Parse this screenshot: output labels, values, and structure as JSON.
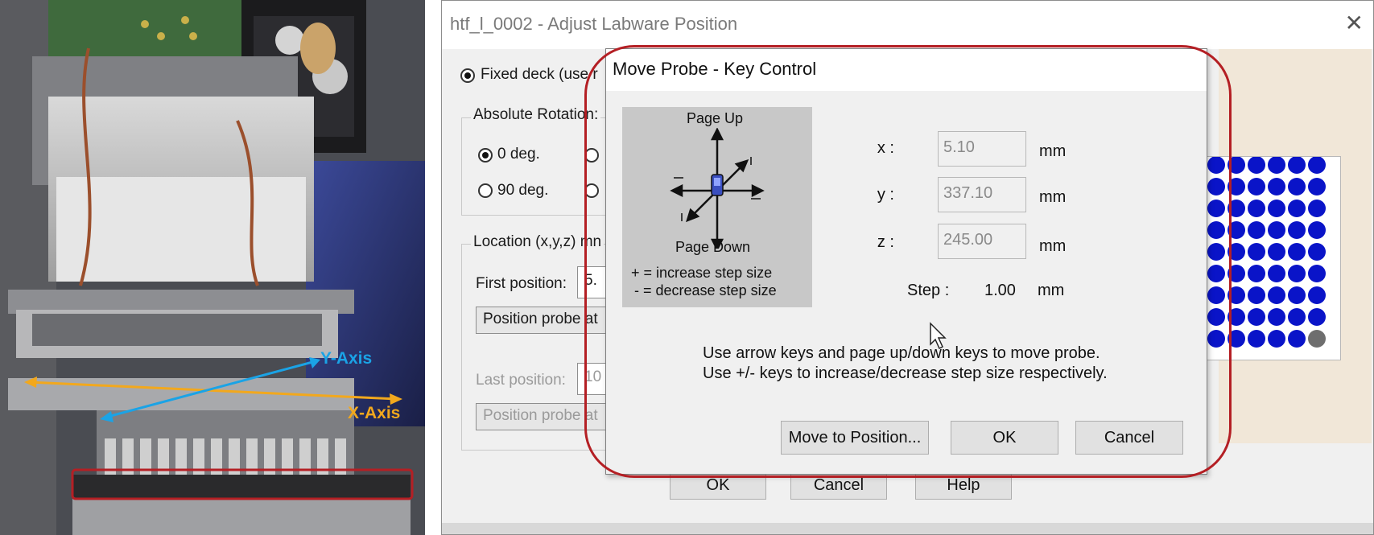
{
  "photo": {
    "y_axis_label": "Y-Axis",
    "x_axis_label": "X-Axis",
    "colors": {
      "y_axis": "#1aa3e6",
      "x_axis": "#f2a81d",
      "highlight": "#b41f24"
    }
  },
  "main_dialog": {
    "title": "htf_l_0002 - Adjust Labware Position",
    "close_icon": "close-icon",
    "fixed_deck_label": "Fixed deck (use r",
    "absolute_rotation_label": "Absolute Rotation:",
    "rotation_options": [
      "0 deg.",
      "90 deg."
    ],
    "location_label": "Location (x,y,z) mn",
    "first_position_label": "First position:",
    "first_position_value": "5.",
    "position_probe_1": "Position probe at",
    "last_position_label": "Last position:",
    "last_position_value": "10",
    "position_probe_2": "Position probe at",
    "buttons": {
      "ok": "OK",
      "cancel": "Cancel",
      "help": "Help"
    }
  },
  "probe_dialog": {
    "title": "Move Probe - Key Control",
    "keypad": {
      "page_up": "Page Up",
      "page_down": "Page Down",
      "increase_hint": "+ = increase step size",
      "decrease_hint": "- = decrease step size"
    },
    "coords": {
      "x_label": "x :",
      "x_value": "5.10",
      "y_label": "y :",
      "y_value": "337.10",
      "z_label": "z :",
      "z_value": "245.00",
      "unit": "mm"
    },
    "step_label": "Step :",
    "step_value": "1.00",
    "step_unit": "mm",
    "help_line_1": "Use arrow keys and page up/down keys to move probe.",
    "help_line_2": "Use +/- keys to increase/decrease step size respectively.",
    "buttons": {
      "move_to": "Move to Position...",
      "ok": "OK",
      "cancel": "Cancel"
    }
  },
  "plate_colors": {
    "well": "#0a14c8",
    "empty_well": "#6e6e6e"
  }
}
